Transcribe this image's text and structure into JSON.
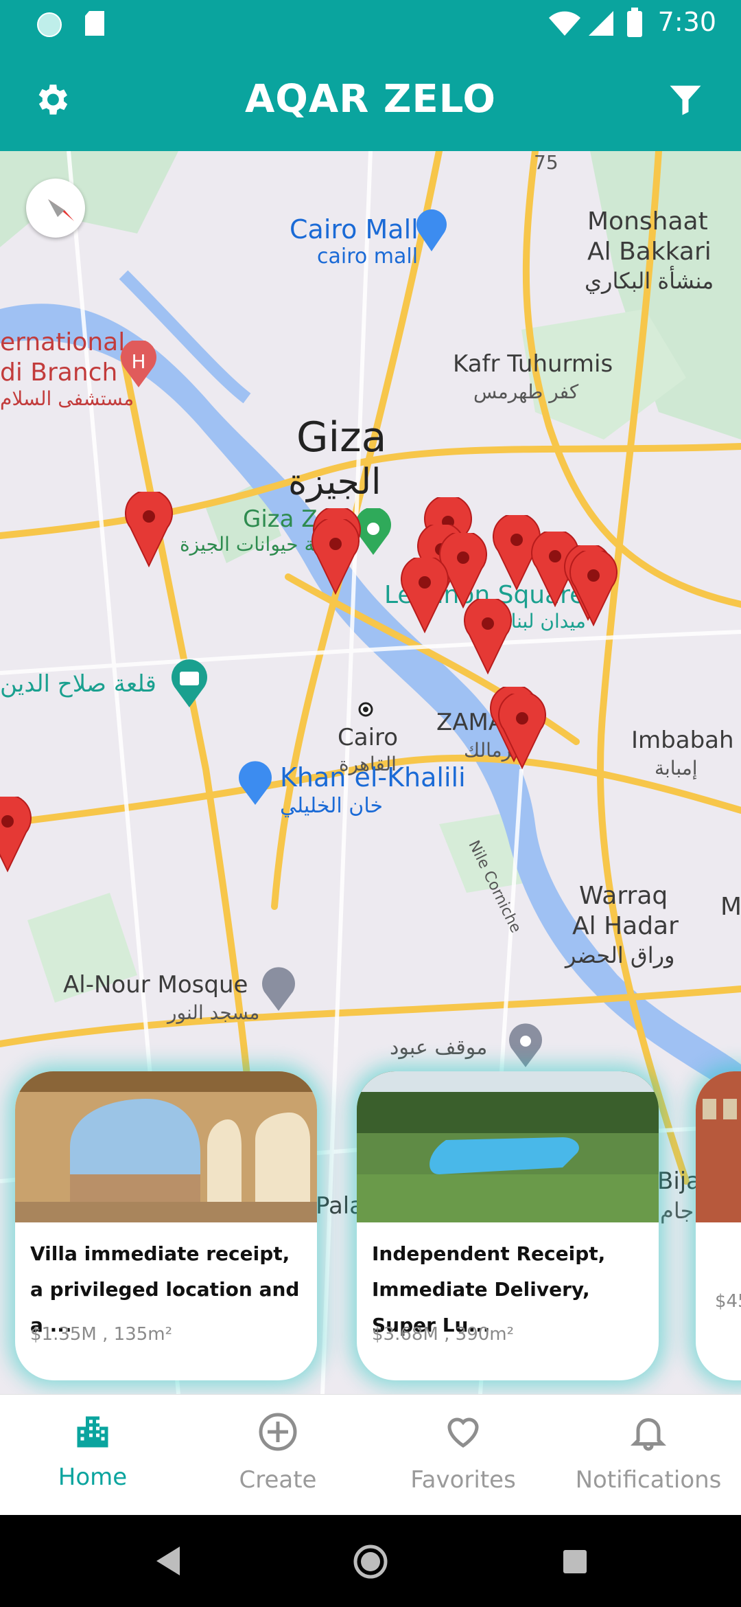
{
  "status_bar": {
    "time": "7:30"
  },
  "app_bar": {
    "title": "AQAR ZELO",
    "settings_icon": "gear-icon",
    "filter_icon": "filter-icon"
  },
  "map": {
    "labels": {
      "cairo_mall": "Cairo Mall",
      "cairo_mall_sub": "cairo mall",
      "monshaat": "Monshaat",
      "al_bakkari": "Al Bakkari",
      "monshaat_ar": "منشأة البكاري",
      "international": "ernational",
      "di_branch": "di Branch",
      "hospital_ar": "مستشفى السلام",
      "kafr": "Kafr Tuhurmis",
      "kafr_ar": "كفر طهرمس",
      "giza": "Giza",
      "giza_ar": "الجيزة",
      "giza_zoo": "Giza Z",
      "giza_zoo_ar": "حديقة حيوانات الجيزة",
      "lebanon_square": "Lebanon Square",
      "lebanon_ar": "ميدان لبنان",
      "citadel_ar": "قلعة صلاح الدين",
      "cairo": "Cairo",
      "cairo_ar": "القاهرة",
      "zamalek": "ZAMA",
      "zamalek_ar": "الزمالك",
      "imbabah": "Imbabah",
      "imbabah_ar": "إمبابة",
      "khan": "Khan el-Khalili",
      "khan_ar": "خان الخليلي",
      "nile_corniche": "Nile Corniche",
      "warraq": "Warraq",
      "al_hadar": "Al Hadar",
      "warraq_ar": "وراق الحضر",
      "alnour": "Al-Nour Mosque",
      "alnour_ar": "مسجد النور",
      "mawqif": "موقف عبود",
      "route_75": "75",
      "m_edge": "M",
      "palace": "Pala",
      "bija": "Bija",
      "bija_ar": "جام"
    }
  },
  "listings": [
    {
      "title": "Villa immediate receipt, a privileged location and a ...",
      "price": "$1.35M",
      "area": "135m²",
      "meta": "$1.35M , 135m²"
    },
    {
      "title": "Independent Receipt, Immediate Delivery, Super Lu...",
      "price": "$3.68M",
      "area": "390m²",
      "meta": "$3.68M , 390m²"
    },
    {
      "title": "",
      "price": "$45",
      "area": "",
      "meta": "$45"
    }
  ],
  "bottom_nav": {
    "items": [
      {
        "label": "Home",
        "icon": "building-icon",
        "active": true
      },
      {
        "label": "Create",
        "icon": "plus-circle-icon",
        "active": false
      },
      {
        "label": "Favorites",
        "icon": "heart-icon",
        "active": false
      },
      {
        "label": "Notifications",
        "icon": "bell-icon",
        "active": false
      }
    ]
  },
  "colors": {
    "primary": "#0aa49e",
    "pin": "#e53935"
  }
}
